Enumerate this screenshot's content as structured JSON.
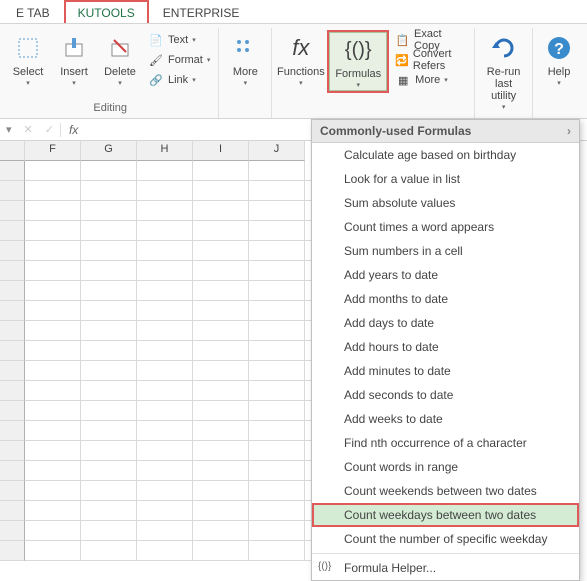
{
  "tabs": {
    "etab": "E TAB",
    "kutools": "KUTOOLS",
    "enterprise": "ENTERPRISE"
  },
  "ribbon": {
    "select": "Select",
    "insert": "Insert",
    "delete": "Delete",
    "text": "Text",
    "format": "Format",
    "link": "Link",
    "editing_group": "Editing",
    "more": "More",
    "functions": "Functions",
    "formulas": "Formulas",
    "exact_copy": "Exact Copy",
    "convert_refers": "Convert Refers",
    "more2": "More",
    "rerun": "Re-run",
    "last_utility": "last utility",
    "help": "Help"
  },
  "cols": [
    "F",
    "G",
    "H",
    "I",
    "J"
  ],
  "menu": {
    "header": "Commonly-used Formulas",
    "items": [
      "Calculate age based on birthday",
      "Look for a value in list",
      "Sum absolute values",
      "Count times a word appears",
      "Sum numbers in a cell",
      "Add years to date",
      "Add months to date",
      "Add days to date",
      "Add hours to date",
      "Add minutes to date",
      "Add seconds to date",
      "Add weeks to date",
      "Find nth occurrence of a character",
      "Count words in range",
      "Count weekends between two dates",
      "Count weekdays between two dates",
      "Count the number of specific weekday"
    ],
    "helper": "Formula Helper..."
  }
}
